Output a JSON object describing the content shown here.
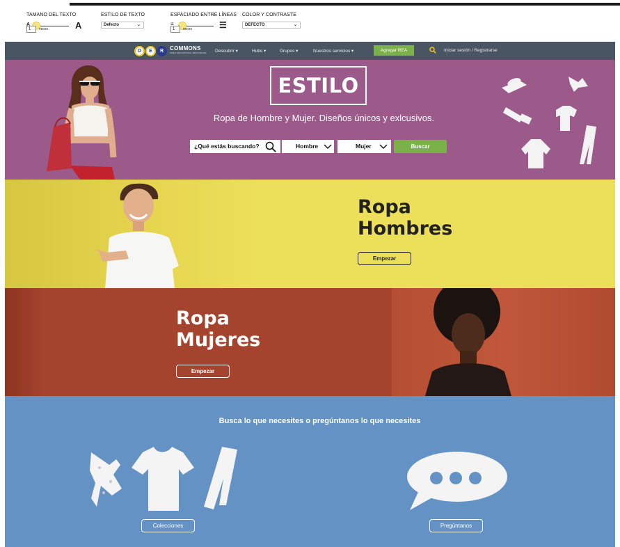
{
  "accessibility": {
    "text_size": {
      "title": "TAMANO DEL TEXTO",
      "small_a": "A",
      "big_a": "A",
      "value": "1",
      "unit": "veces"
    },
    "text_style": {
      "title": "ESTILO DE TEXTO",
      "selected": "Defecto"
    },
    "line_spacing": {
      "title": "ESPACIADO ENTRE LÍNEAS",
      "value": "1",
      "unit": "veces"
    },
    "contrast": {
      "title": "COLOR Y CONTRASTE",
      "selected": "DEFECTO"
    }
  },
  "nav": {
    "logo": {
      "letters": [
        "O",
        "E",
        "R"
      ],
      "name": "COMMONS",
      "tagline": "OPEN EDUCATIONAL RESOURCES"
    },
    "items": [
      {
        "label": "Descubrir"
      },
      {
        "label": "Hubs"
      },
      {
        "label": "Grupos"
      },
      {
        "label": "Nuestros servicios"
      }
    ],
    "add_button": "Agregar REA",
    "login": "Iniciar sesión / Registrarse"
  },
  "hero": {
    "title": "ESTILO",
    "subtitle": "Ropa de Hombre y Mujer. Diseños únicos y exlcusivos.",
    "search_placeholder": "¿Qué estás buscando?",
    "dropdown_men": "Hombre",
    "dropdown_women": "Mujer",
    "search_button": "Buscar"
  },
  "men": {
    "title_line1": "Ropa",
    "title_line2": "Hombres",
    "button": "Empezar"
  },
  "women": {
    "title_line1": "Ropa",
    "title_line2": "Mujeres",
    "button": "Empezar"
  },
  "help": {
    "heading": "Busca lo que necesites o pregúntanos lo que necesites",
    "collections_button": "Colecciones",
    "ask_button": "Pregúntanos"
  },
  "colors": {
    "hero_bg": "#9b5a8a",
    "nav_bg": "#4a5563",
    "accent_green": "#7bb04a",
    "men_bg": "#ecdf5a",
    "women_bg": "#a5442e",
    "help_bg": "#6492c4"
  }
}
